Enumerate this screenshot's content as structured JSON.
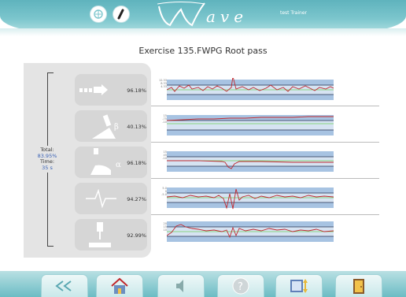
{
  "header": {
    "trainer": "test Trainer",
    "logo_text": "ave"
  },
  "exercise_title": "Exercise 135.FWPG Root pass",
  "summary": {
    "total_label": "Total:",
    "total_value": "83.95%",
    "time_label": "Time:",
    "time_value": "35 s"
  },
  "parameters": [
    {
      "icon": "travel-speed-icon",
      "percent": "96.18%",
      "ticks": [
        "12.33",
        "8.33",
        "4.33"
      ]
    },
    {
      "icon": "work-angle-beta-icon",
      "percent": "40.13%",
      "ticks": [
        "15",
        "-75",
        "-10"
      ]
    },
    {
      "icon": "travel-angle-alpha-icon",
      "percent": "96.18%",
      "ticks": [
        "15",
        "45",
        "-10"
      ]
    },
    {
      "icon": "weave-icon",
      "percent": "94.27%",
      "ticks": [
        "5.0",
        "0",
        "-5.0"
      ]
    },
    {
      "icon": "stickout-icon",
      "percent": "92.99%",
      "ticks": [
        "20",
        "15",
        "10"
      ]
    }
  ],
  "footer_buttons": [
    "back-button",
    "home-button",
    "sound-button",
    "help-button",
    "report-button",
    "exit-button"
  ],
  "colors": {
    "header": "#6bbcc4",
    "band": "#a7c3e2",
    "trace": "#c0282d",
    "target": "#6fcf5c",
    "limits": "#23304f"
  }
}
